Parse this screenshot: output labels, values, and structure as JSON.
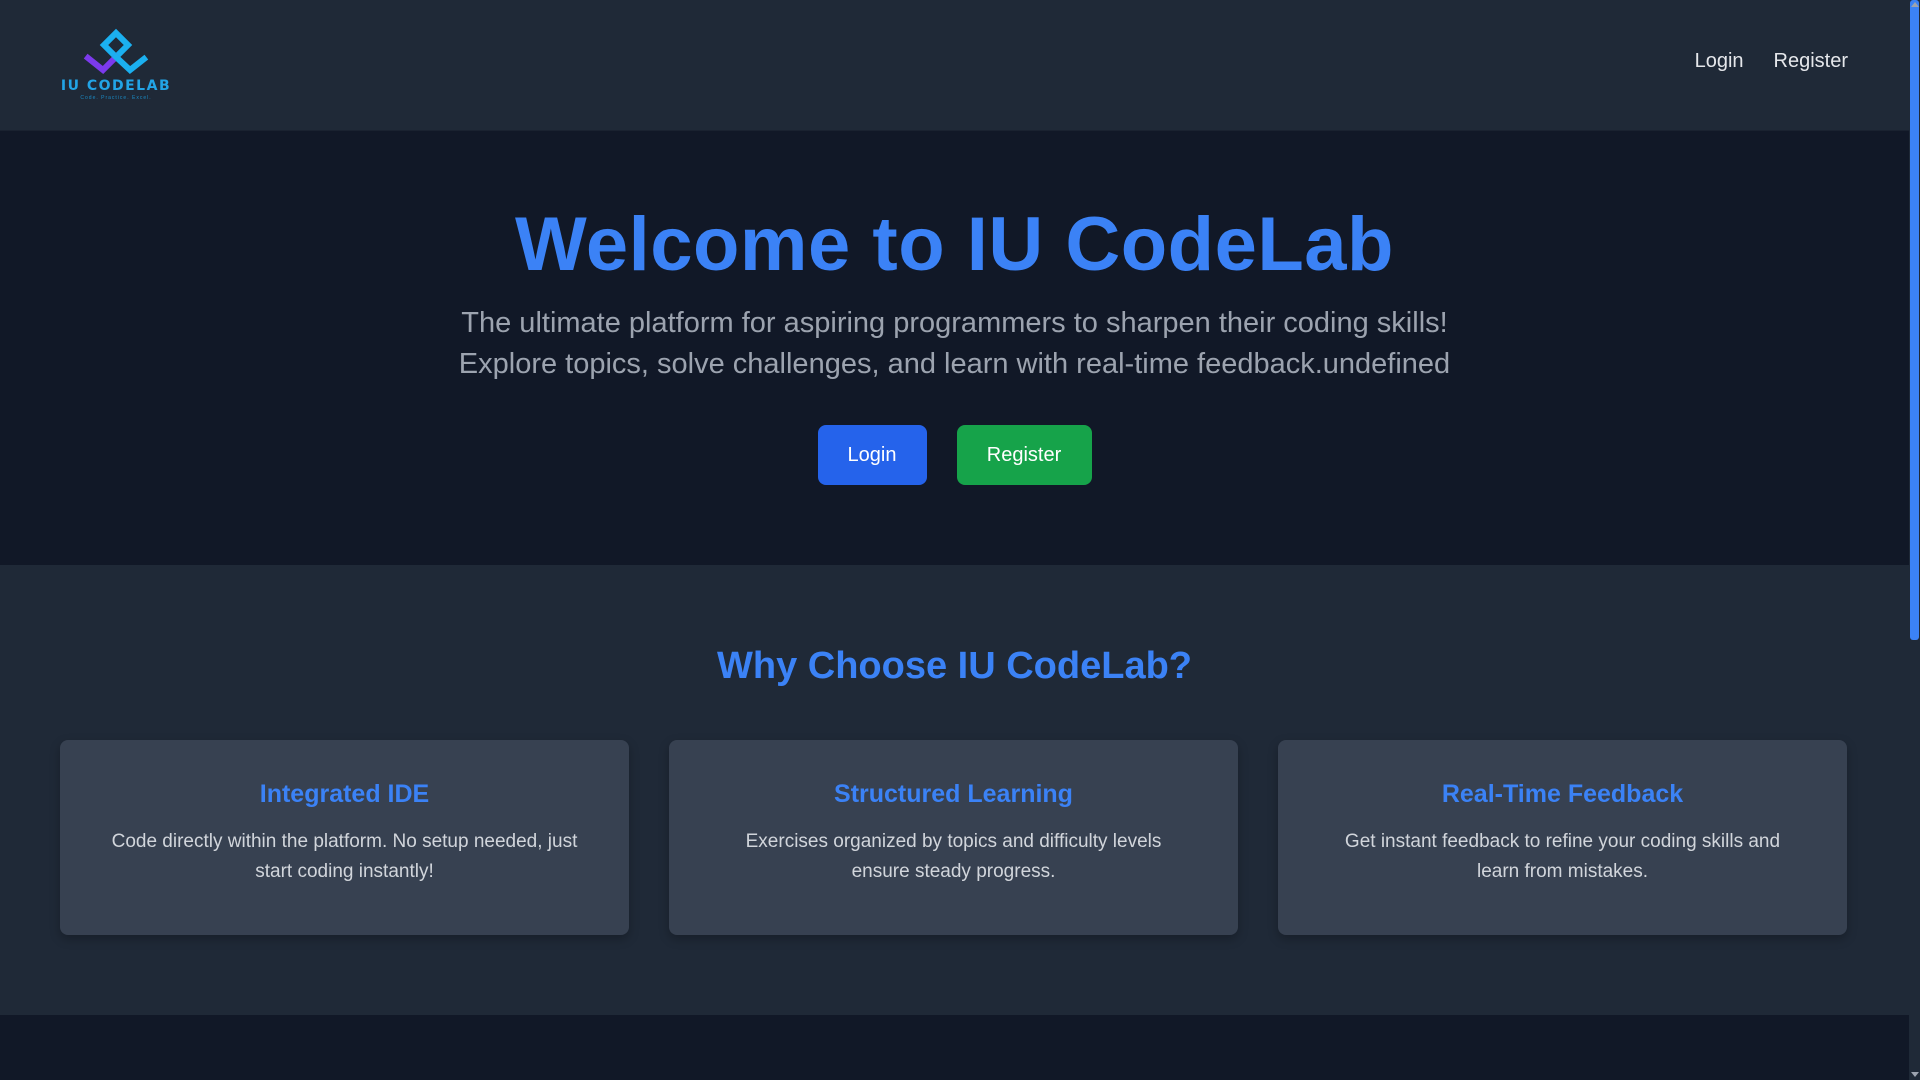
{
  "navbar": {
    "logo": {
      "icon": "iu-codelab-logo-icon",
      "text": "IU CODELAB",
      "tagline": "Code. Practice. Excel.",
      "colors": {
        "blue": "#1bb0f0",
        "purple": "#7c3aed"
      }
    },
    "links": [
      {
        "label": "Login"
      },
      {
        "label": "Register"
      }
    ]
  },
  "hero": {
    "title": "Welcome to IU CodeLab",
    "subtitle_line1": "The ultimate platform for aspiring programmers to sharpen their coding skills!",
    "subtitle_line2": "Explore topics, solve challenges, and learn with real-time feedback.undefined",
    "buttons": {
      "login_label": "Login",
      "register_label": "Register"
    }
  },
  "features": {
    "title": "Why Choose IU CodeLab?",
    "cards": [
      {
        "title": "Integrated IDE",
        "text": "Code directly within the platform. No setup needed, just start coding instantly!"
      },
      {
        "title": "Structured Learning",
        "text": "Exercises organized by topics and difficulty levels ensure steady progress."
      },
      {
        "title": "Real-Time Feedback",
        "text": "Get instant feedback to refine your coding skills and learn from mistakes."
      }
    ]
  },
  "theme": {
    "accent": "#3b82f6",
    "login_button": "#2563eb",
    "register_button": "#16a34a",
    "background_dark": "#111827",
    "background_panel": "#1f2937",
    "card_background": "#374151"
  }
}
